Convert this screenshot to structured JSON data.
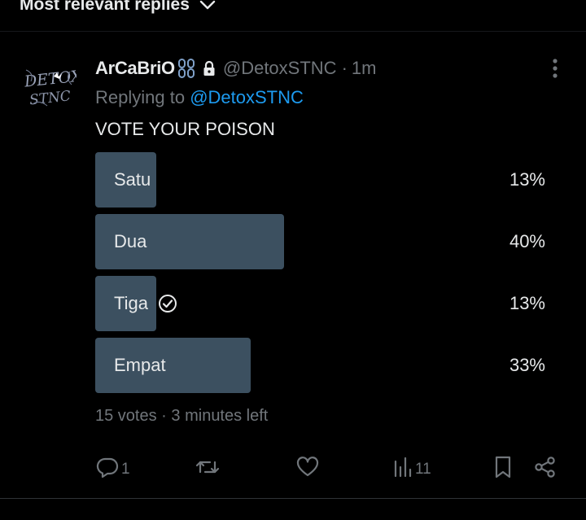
{
  "header": {
    "sort_label": "Most relevant replies"
  },
  "tweet": {
    "display_name": "ArCaBriO",
    "handle": "@DetoxSTNC",
    "separator": "·",
    "time": "1m",
    "replying_prefix": "Replying to ",
    "replying_to": "@DetoxSTNC",
    "text": "VOTE YOUR POISON",
    "avatar_text": "DETOX STNC"
  },
  "poll": {
    "options": [
      {
        "label": "Satu",
        "percent_text": "13%",
        "percent": 13,
        "selected": false
      },
      {
        "label": "Dua",
        "percent_text": "40%",
        "percent": 40,
        "selected": false
      },
      {
        "label": "Tiga",
        "percent_text": "13%",
        "percent": 13,
        "selected": true
      },
      {
        "label": "Empat",
        "percent_text": "33%",
        "percent": 33,
        "selected": false
      }
    ],
    "votes": "15 votes",
    "meta_separator": "·",
    "time_left": "3 minutes left"
  },
  "actions": {
    "replies": "1",
    "views": "11"
  },
  "colors": {
    "background": "#000000",
    "poll_bar": "#3c5060",
    "text_secondary": "#71767b",
    "link": "#1d9bf0"
  }
}
